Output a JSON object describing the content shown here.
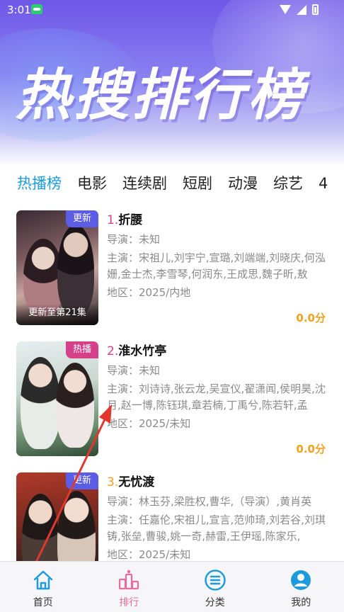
{
  "status_bar": {
    "time": "3:01"
  },
  "hero": {
    "title": "热搜排行榜"
  },
  "tabs": [
    {
      "label": "热播榜",
      "active": true
    },
    {
      "label": "电影",
      "active": false
    },
    {
      "label": "连续剧",
      "active": false
    },
    {
      "label": "短剧",
      "active": false
    },
    {
      "label": "动漫",
      "active": false
    },
    {
      "label": "综艺",
      "active": false
    },
    {
      "label": "4",
      "active": false
    }
  ],
  "items": [
    {
      "rank": "1.",
      "rank_color": "#d6408b",
      "name": "折腰",
      "badge": "更新",
      "badge_color": "blue",
      "poster_caption": "更新至第21集",
      "director": "导演：未知",
      "cast": "主演：宋祖儿,刘宇宁,宣璐,刘端端,刘晓庆,何泓姗,金士杰,李雪琴,何润东,王成思,魏子昕,敖",
      "region": "地区：2025/内地",
      "score": "0.0分"
    },
    {
      "rank": "2.",
      "rank_color": "#d6408b",
      "name": "淮水竹亭",
      "badge": "热播",
      "badge_color": "pink",
      "poster_caption": "",
      "director": "导演：未知",
      "cast": "主演：刘诗诗,张云龙,吴宣仪,翟潇闻,侯明昊,沈月,赵一博,陈钰琪,章若楠,丁禹兮,陈若轩,孟",
      "region": "地区：2025/未知",
      "score": "0.0分"
    },
    {
      "rank": "3.",
      "rank_color": "#f3a11c",
      "name": "无忧渡",
      "badge": "更新",
      "badge_color": "blue",
      "poster_caption": "",
      "director": "导演：林玉芬,梁胜权,曹华,（导演）,黄肖英",
      "cast": "主演：任嘉伦,宋祖儿,宣言,范帅琦,刘若谷,刘琪铸,张垒,曹骏,姚一奇,赫雷,王伊瑶,陈家乐,",
      "region": "地区：2025/未知",
      "score": ""
    }
  ],
  "bottom_nav": [
    {
      "label": "首页",
      "icon": "home-icon",
      "active": false
    },
    {
      "label": "排行",
      "icon": "ranking-icon",
      "active": true
    },
    {
      "label": "分类",
      "icon": "category-icon",
      "active": false
    },
    {
      "label": "我的",
      "icon": "profile-icon",
      "active": false
    }
  ],
  "colors": {
    "accent_tab": "#1e9bdc",
    "score": "#f3a11c",
    "nav_active": "#e86aa0",
    "nav_icon": "#1e9bdc"
  }
}
